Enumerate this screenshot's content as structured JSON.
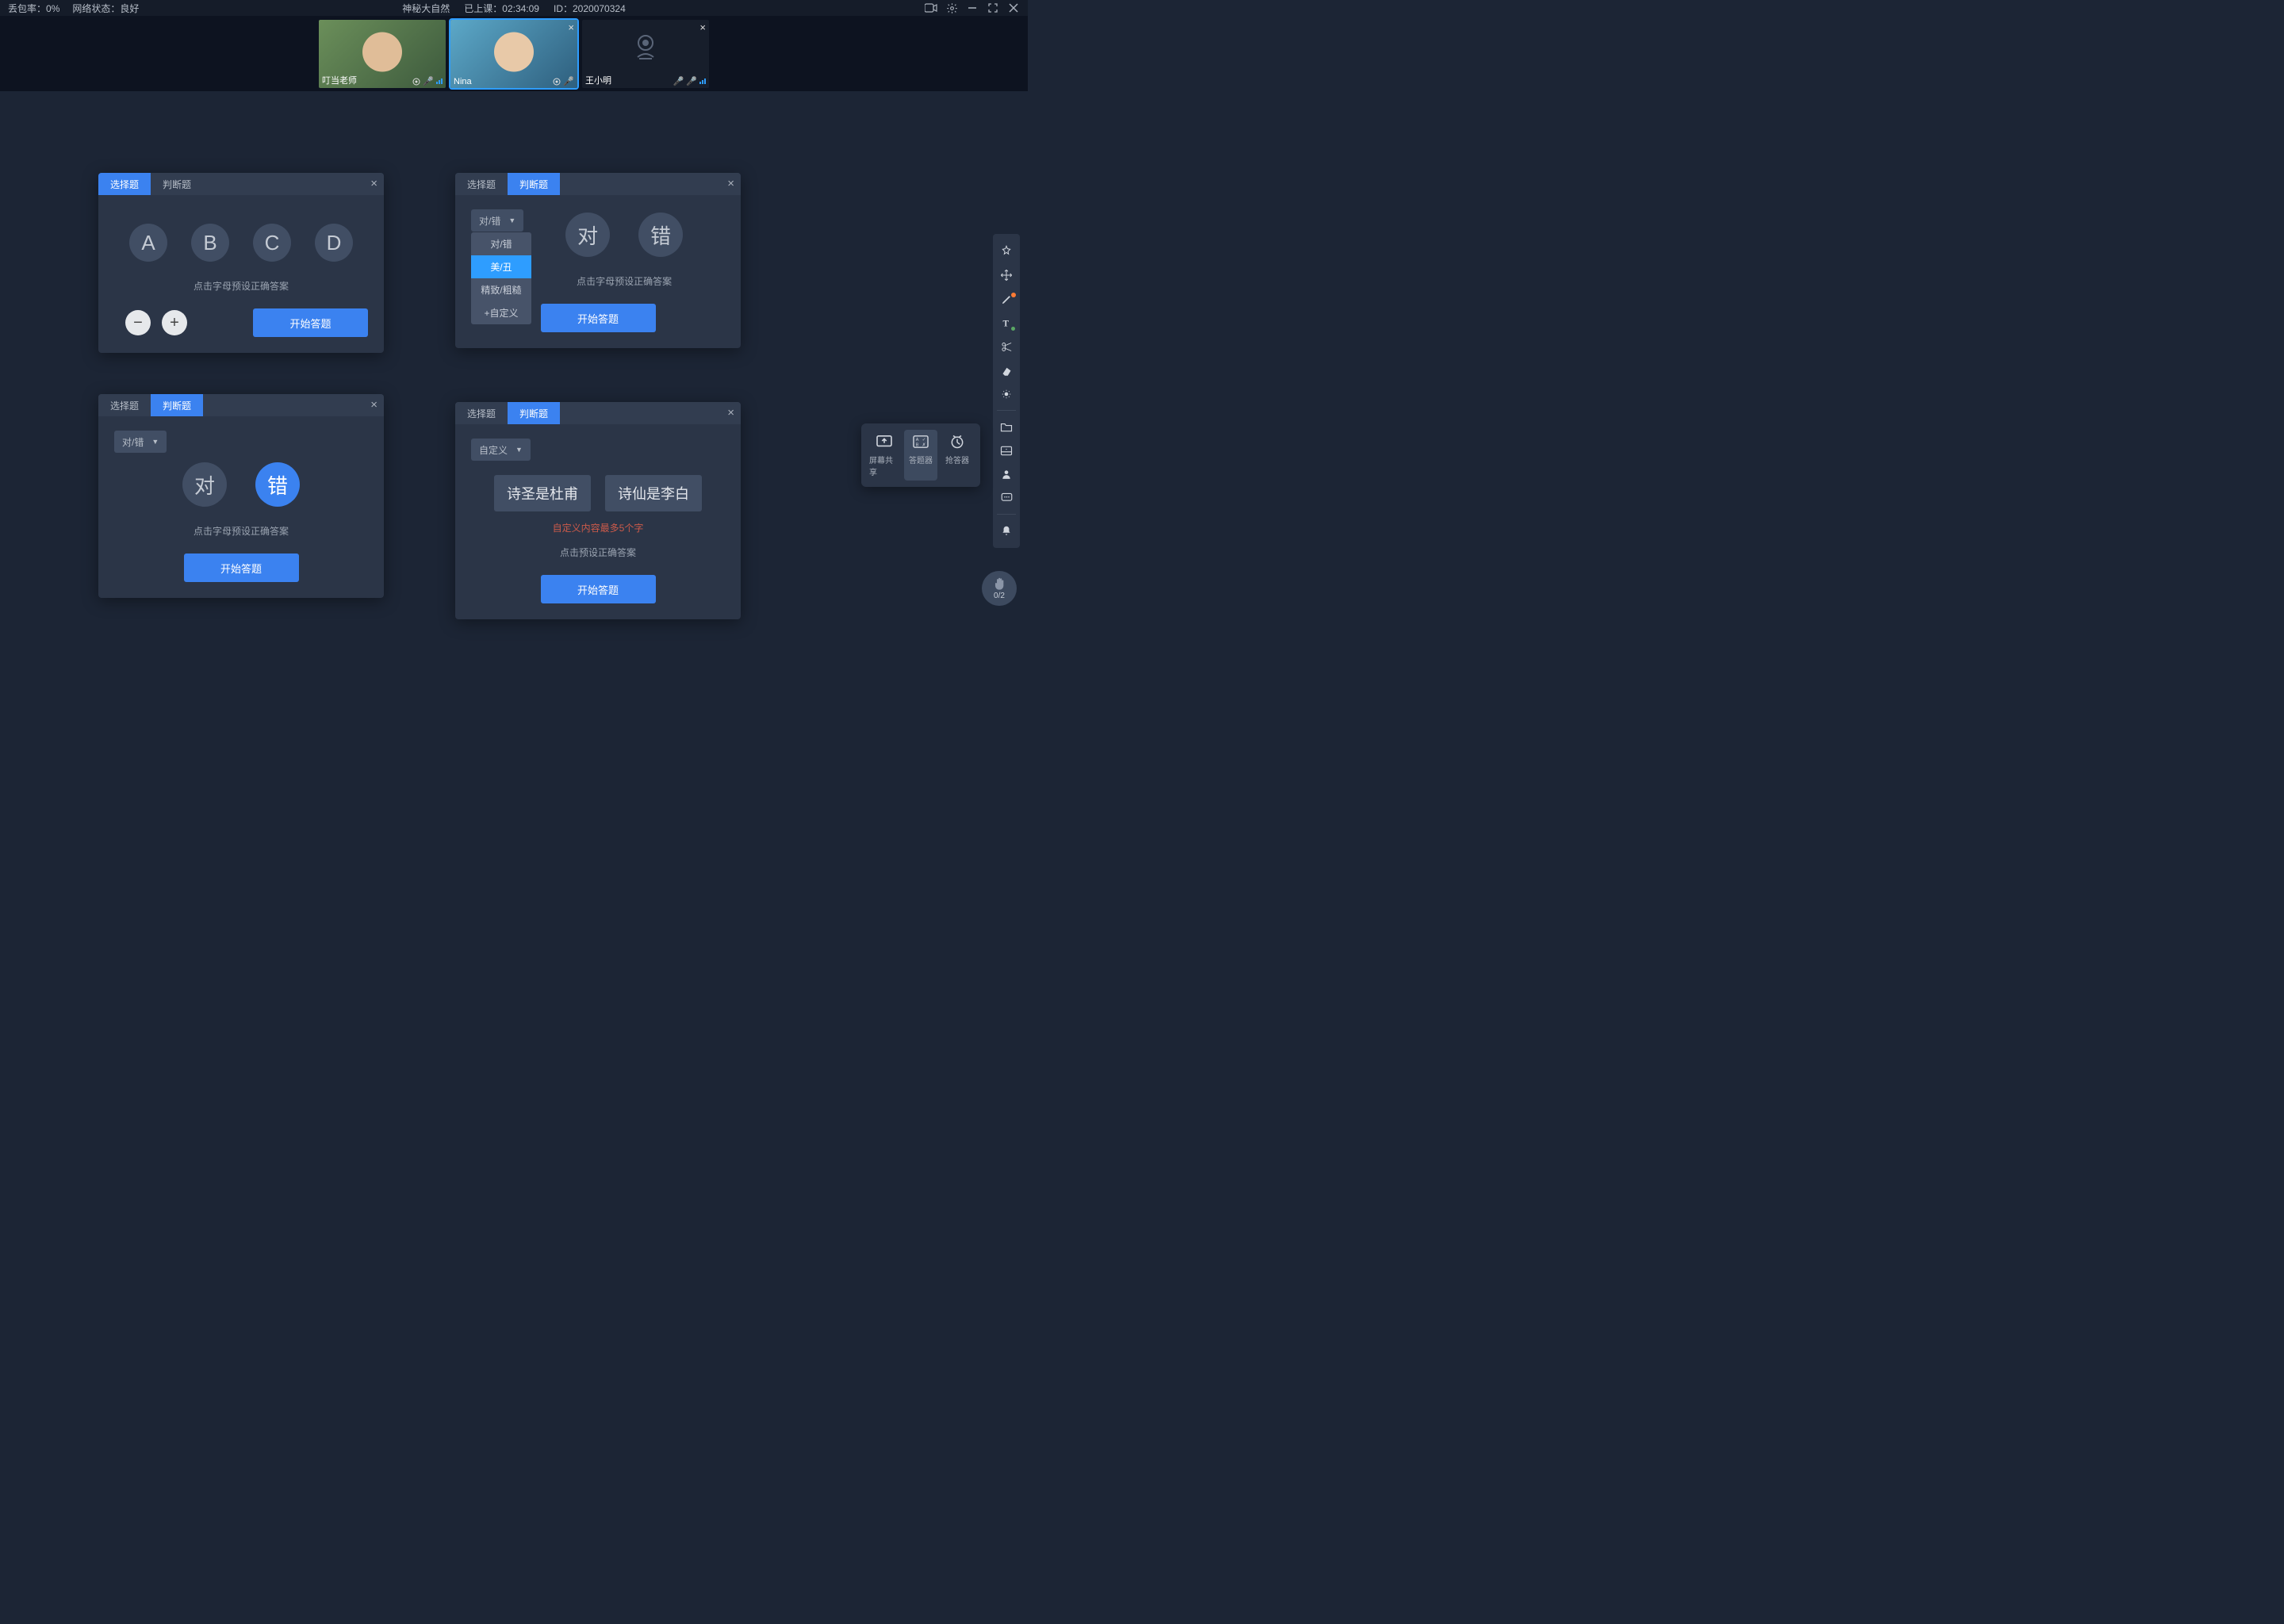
{
  "statusbar": {
    "packet_loss_label": "丢包率：",
    "packet_loss_value": "0%",
    "network_label": "网络状态：",
    "network_value": "良好",
    "title": "神秘大自然",
    "elapsed_label": "已上课：",
    "elapsed_value": "02:34:09",
    "id_label": "ID：",
    "id_value": "2020070324"
  },
  "participants": [
    {
      "name": "叮当老师",
      "has_close": false,
      "camera_off": false,
      "muted": false
    },
    {
      "name": "Nina",
      "has_close": true,
      "camera_off": false,
      "muted": false,
      "active": true
    },
    {
      "name": "王小明",
      "has_close": true,
      "camera_off": true,
      "muted": true
    }
  ],
  "common": {
    "tab_choice": "选择题",
    "tab_truefalse": "判断题",
    "hint_preset_letter": "点击字母预设正确答案",
    "hint_preset": "点击预设正确答案",
    "start_button": "开始答题"
  },
  "panel1": {
    "letters": [
      "A",
      "B",
      "C",
      "D"
    ]
  },
  "panel2": {
    "select_label": "对/错",
    "tf": [
      "对",
      "错"
    ],
    "dropdown": [
      "对/错",
      "美/丑",
      "精致/粗糙",
      "+自定义"
    ],
    "dropdown_hover_index": 1
  },
  "panel3": {
    "select_label": "对/错",
    "tf": [
      "对",
      "错"
    ],
    "selected_index": 1
  },
  "panel4": {
    "select_label": "自定义",
    "options": [
      "诗圣是杜甫",
      "诗仙是李白"
    ],
    "warn": "自定义内容最多5个字"
  },
  "share_toolbar": {
    "items": [
      {
        "label": "屏幕共享",
        "icon": "screen-share"
      },
      {
        "label": "答题器",
        "icon": "answer-tool",
        "active": true
      },
      {
        "label": "抢答器",
        "icon": "buzzer"
      }
    ]
  },
  "hand": {
    "count": "0/2"
  }
}
